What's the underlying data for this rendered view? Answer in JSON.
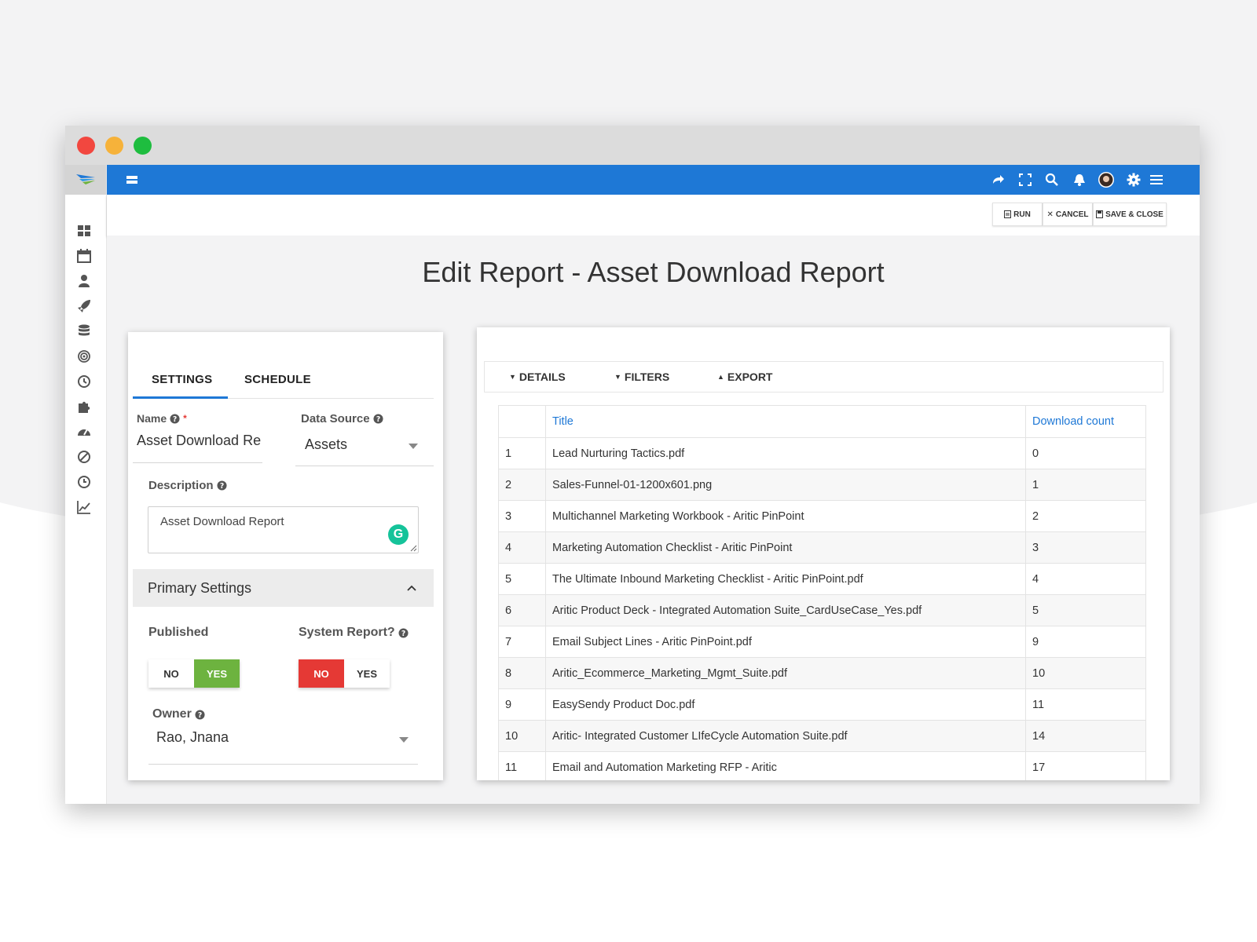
{
  "topbar": {
    "menu_icon": "menu-icon",
    "icons": [
      "share-icon",
      "fullscreen-icon",
      "search-icon",
      "bell-icon",
      "avatar",
      "gear-icon",
      "hamburger-icon"
    ]
  },
  "sidebar": {
    "icons": [
      "dashboard-icon",
      "calendar-icon",
      "user-icon",
      "rocket-icon",
      "database-icon",
      "target-icon",
      "clock-icon",
      "puzzle-icon",
      "gauge-icon",
      "ban-icon",
      "history-icon",
      "chart-line-icon"
    ]
  },
  "toolbar": {
    "run_label": "RUN",
    "cancel_label": "CANCEL",
    "save_close_label": "SAVE & CLOSE"
  },
  "page": {
    "title": "Edit Report - Asset Download Report"
  },
  "settings": {
    "tabs": [
      {
        "label": "SETTINGS",
        "active": true
      },
      {
        "label": "SCHEDULE",
        "active": false
      }
    ],
    "name_label": "Name",
    "name_required": "*",
    "name_value": "Asset Download Rep",
    "data_source_label": "Data Source",
    "data_source_value": "Assets",
    "description_label": "Description",
    "description_value": "Asset Download Report",
    "primary_settings_label": "Primary Settings",
    "published_label": "Published",
    "published_no": "NO",
    "published_yes": "YES",
    "published_value": "YES",
    "system_report_label": "System Report?",
    "system_no": "NO",
    "system_yes": "YES",
    "system_value": "NO",
    "owner_label": "Owner",
    "owner_value": "Rao, Jnana"
  },
  "report": {
    "tabs": [
      {
        "label": "DETAILS",
        "arrow": "▼"
      },
      {
        "label": "FILTERS",
        "arrow": "▼"
      },
      {
        "label": "EXPORT",
        "arrow": "▲"
      }
    ],
    "columns": [
      "",
      "Title",
      "Download count"
    ],
    "rows": [
      {
        "n": "1",
        "title": "Lead Nurturing Tactics.pdf",
        "count": "0"
      },
      {
        "n": "2",
        "title": "Sales-Funnel-01-1200x601.png",
        "count": "1"
      },
      {
        "n": "3",
        "title": "Multichannel Marketing Workbook - Aritic PinPoint",
        "count": "2"
      },
      {
        "n": "4",
        "title": "Marketing Automation Checklist - Aritic PinPoint",
        "count": "3"
      },
      {
        "n": "5",
        "title": "The Ultimate Inbound Marketing Checklist - Aritic PinPoint.pdf",
        "count": "4"
      },
      {
        "n": "6",
        "title": "Aritic Product Deck - Integrated Automation Suite_CardUseCase_Yes.pdf",
        "count": "5"
      },
      {
        "n": "7",
        "title": "Email Subject Lines - Aritic PinPoint.pdf",
        "count": "9"
      },
      {
        "n": "8",
        "title": "Aritic_Ecommerce_Marketing_Mgmt_Suite.pdf",
        "count": "10"
      },
      {
        "n": "9",
        "title": "EasySendy Product Doc.pdf",
        "count": "11"
      },
      {
        "n": "10",
        "title": "Aritic- Integrated Customer LIfeCycle Automation Suite.pdf",
        "count": "14"
      },
      {
        "n": "11",
        "title": "Email and Automation Marketing RFP - Aritic",
        "count": "17"
      },
      {
        "n": "",
        "title": "",
        "count": ""
      }
    ]
  },
  "colors": {
    "brand_blue": "#1e78d6",
    "yes_green": "#6db33f",
    "no_red": "#e53935",
    "grammarly": "#15c39a"
  }
}
